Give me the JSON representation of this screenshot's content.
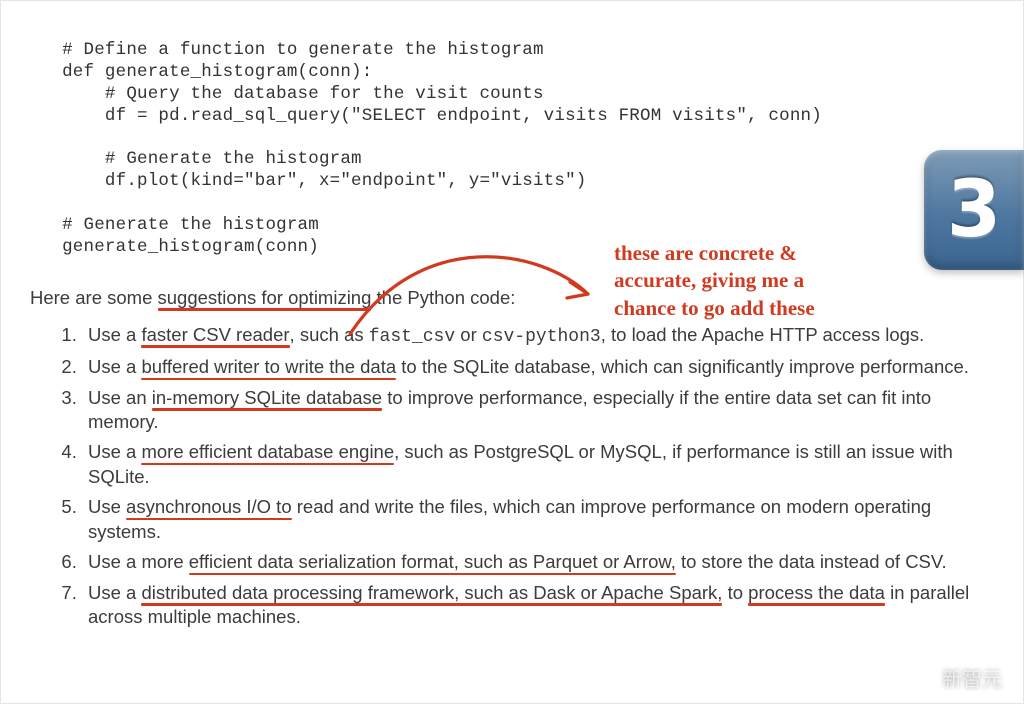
{
  "badge_number": "3",
  "code": {
    "c1": "   # Define a function to generate the histogram",
    "c2": "   def generate_histogram(conn):",
    "c3": "       # Query the database for the visit counts",
    "c4": "       df = pd.read_sql_query(\"SELECT endpoint, visits FROM visits\", conn)",
    "c5": "",
    "c6": "       # Generate the histogram",
    "c7": "       df.plot(kind=\"bar\", x=\"endpoint\", y=\"visits\")",
    "c8": "",
    "c9": "   # Generate the histogram",
    "c10": "   generate_histogram(conn)"
  },
  "intro": {
    "pre": "Here are some ",
    "ul": "suggestions for optimizing",
    "post": " the Python code:"
  },
  "annotation": {
    "l1": "these are concrete &",
    "l2": "accurate, giving me a",
    "l3": "chance to go add these"
  },
  "items": {
    "1": {
      "a": "Use a ",
      "u1": "faster CSV reader",
      "b": ", such as ",
      "m1": "fast_csv",
      "c": " or ",
      "m2": "csv-python3",
      "d": ", to load the Apache HTTP access logs."
    },
    "2": {
      "a": "Use a ",
      "u1": "buffered writer to write the data",
      "b": " to the SQLite database, which can significantly improve performance."
    },
    "3": {
      "a": "Use an ",
      "u1": "in-memory SQLite database",
      "b": " to improve performance, especially if the entire data set can fit into memory."
    },
    "4": {
      "a": "Use a ",
      "u1": "more efficient database engine",
      "b": ", such as PostgreSQL or MySQL, if performance is still an issue with SQLite."
    },
    "5": {
      "a": "Use ",
      "u1": "asynchronous I/O to",
      "b": " read and write the files, which can improve performance on modern operating systems."
    },
    "6": {
      "a": "Use a more ",
      "u1": "efficient data serialization format, such as Parquet or Arrow,",
      "b": " to store the data instead of CSV."
    },
    "7": {
      "a": "Use a ",
      "u1": "distributed data processing framework, such as Dask or Apache Spark,",
      "b": " to ",
      "u2": "process the data",
      "c": " in parallel across multiple machines."
    }
  },
  "watermark": "新智元"
}
